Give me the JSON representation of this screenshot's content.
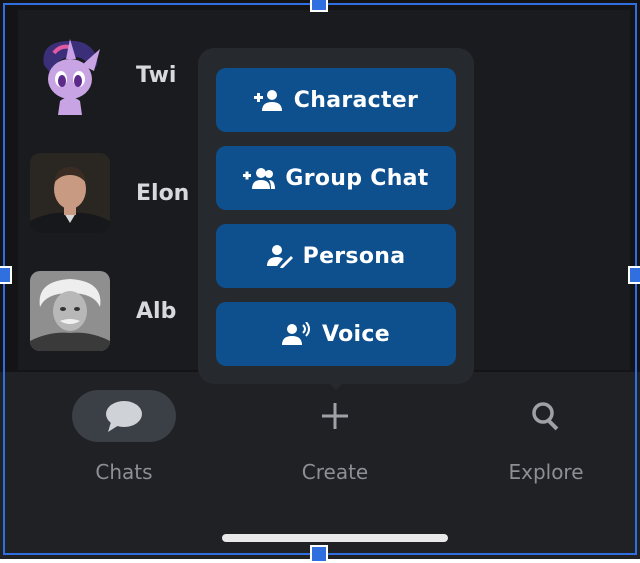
{
  "chats": [
    {
      "name": "Twi",
      "avatar": "pony-avatar"
    },
    {
      "name": "Elon",
      "avatar": "man-portrait-avatar"
    },
    {
      "name": "Alb",
      "avatar": "einstein-portrait-avatar"
    }
  ],
  "create_menu": {
    "items": [
      {
        "label": "Character",
        "icon": "person-add-icon"
      },
      {
        "label": "Group Chat",
        "icon": "group-add-icon"
      },
      {
        "label": "Persona",
        "icon": "person-edit-icon"
      },
      {
        "label": "Voice",
        "icon": "person-voice-icon"
      }
    ]
  },
  "tabbar": {
    "chats_label": "Chats",
    "create_label": "Create",
    "explore_label": "Explore"
  },
  "colors": {
    "accent": "#0e4f8e",
    "selection": "#2f6fe0",
    "background": "#141416"
  }
}
